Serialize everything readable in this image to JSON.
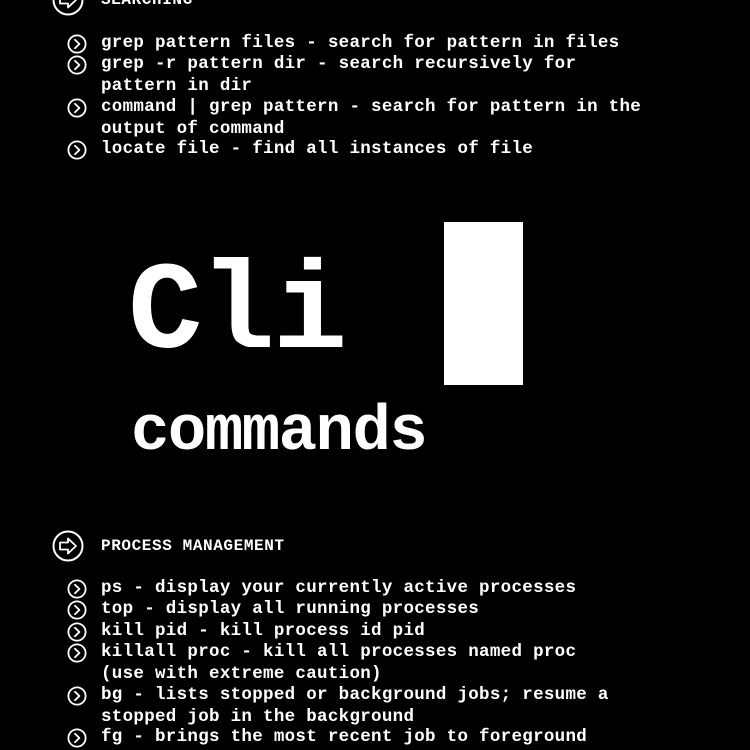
{
  "searching": {
    "title": "SEARCHING",
    "header_icon": "circled-right-arrow-icon",
    "items": [
      "grep pattern files - search for pattern in files",
      "grep -r pattern dir - search recursively for\npattern in dir",
      "command | grep pattern - search for pattern in the\noutput of command",
      "locate file - find all instances of file"
    ]
  },
  "logo": {
    "word": "Cli",
    "subtitle": "commands"
  },
  "process": {
    "title": "PROCESS MANAGEMENT",
    "header_icon": "circled-right-arrow-icon",
    "items": [
      "ps - display your currently active processes",
      "top - display all running processes",
      "kill pid - kill process id pid",
      "killall proc - kill all processes named proc\n(use with extreme caution)",
      "bg - lists stopped or background jobs; resume a\nstopped job in the background",
      "fg - brings the most recent job to foreground"
    ]
  },
  "bullet_icon": "circled-chevron-right-icon",
  "colors": {
    "background": "#000000",
    "foreground": "#ffffff"
  }
}
